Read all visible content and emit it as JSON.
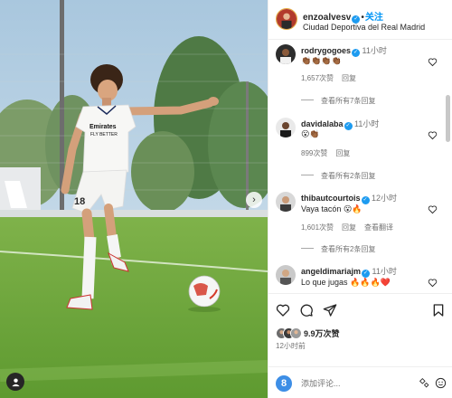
{
  "post": {
    "username": "enzoalvesv",
    "follow_label": "关注",
    "location": "Ciudad Deportiva del Real Madrid",
    "jersey_sponsor": "Fly Emirates",
    "jersey_sponsor_line1": "Emirates",
    "jersey_sponsor_line2": "FLY BETTER",
    "jersey_number": "18"
  },
  "comments": [
    {
      "username": "rodrygogoes",
      "time": "11小时",
      "text": "👏🏾👏🏾👏🏾👏🏾",
      "likes": "1,657次赞",
      "reply": "回复",
      "view_replies": "查看所有7条回复"
    },
    {
      "username": "davidalaba",
      "time": "11小时",
      "text": "😮👏🏾",
      "likes": "899次赞",
      "reply": "回复",
      "view_replies": "查看所有2条回复"
    },
    {
      "username": "thibautcourtois",
      "time": "12小时",
      "text": "Vaya tacón 😮🔥",
      "likes": "1,601次赞",
      "reply": "回复",
      "translate": "查看翻译",
      "view_replies": "查看所有2条回复"
    },
    {
      "username": "angeldimariajm",
      "time": "11小时",
      "text": "Lo que jugas 🔥🔥🔥❤️"
    }
  ],
  "footer": {
    "likes": "9.9万次赞",
    "post_time": "12小时前",
    "comment_placeholder": "添加评论...",
    "commenter_initial": "8"
  },
  "colors": {
    "follow": "#0095f6",
    "verified": "#1d9bf0",
    "text": "#262626",
    "secondary": "#737373"
  },
  "icons": [
    "heart-icon",
    "comment-icon",
    "share-icon",
    "bookmark-icon",
    "emoji-icon",
    "tag-user-icon",
    "next-arrow-icon"
  ]
}
